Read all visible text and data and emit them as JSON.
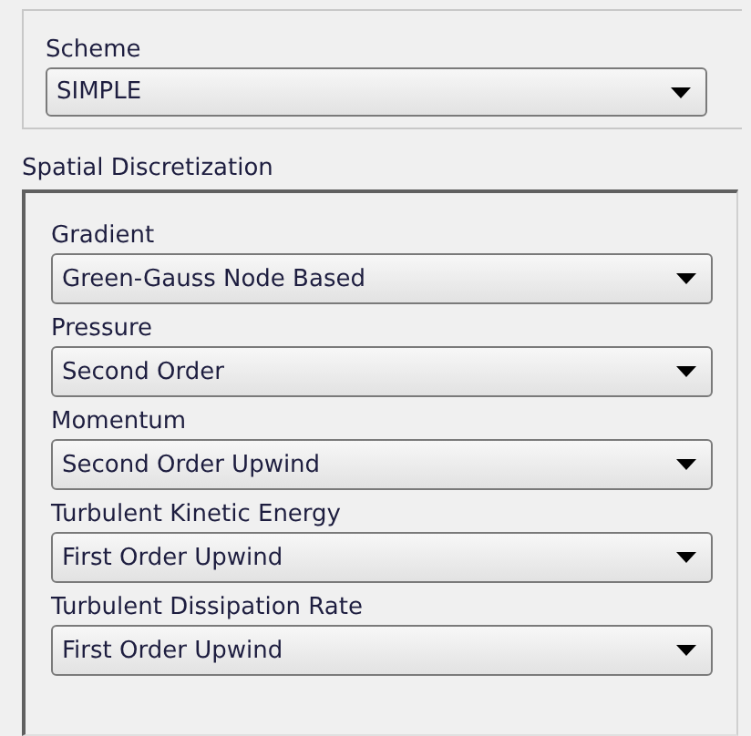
{
  "scheme": {
    "label": "Scheme",
    "value": "SIMPLE"
  },
  "spatial_discretization": {
    "title": "Spatial Discretization",
    "fields": [
      {
        "label": "Gradient",
        "value": "Green-Gauss Node Based"
      },
      {
        "label": "Pressure",
        "value": "Second Order"
      },
      {
        "label": "Momentum",
        "value": "Second Order Upwind"
      },
      {
        "label": "Turbulent Kinetic Energy",
        "value": "First Order Upwind"
      },
      {
        "label": "Turbulent Dissipation Rate",
        "value": "First Order Upwind"
      }
    ]
  }
}
